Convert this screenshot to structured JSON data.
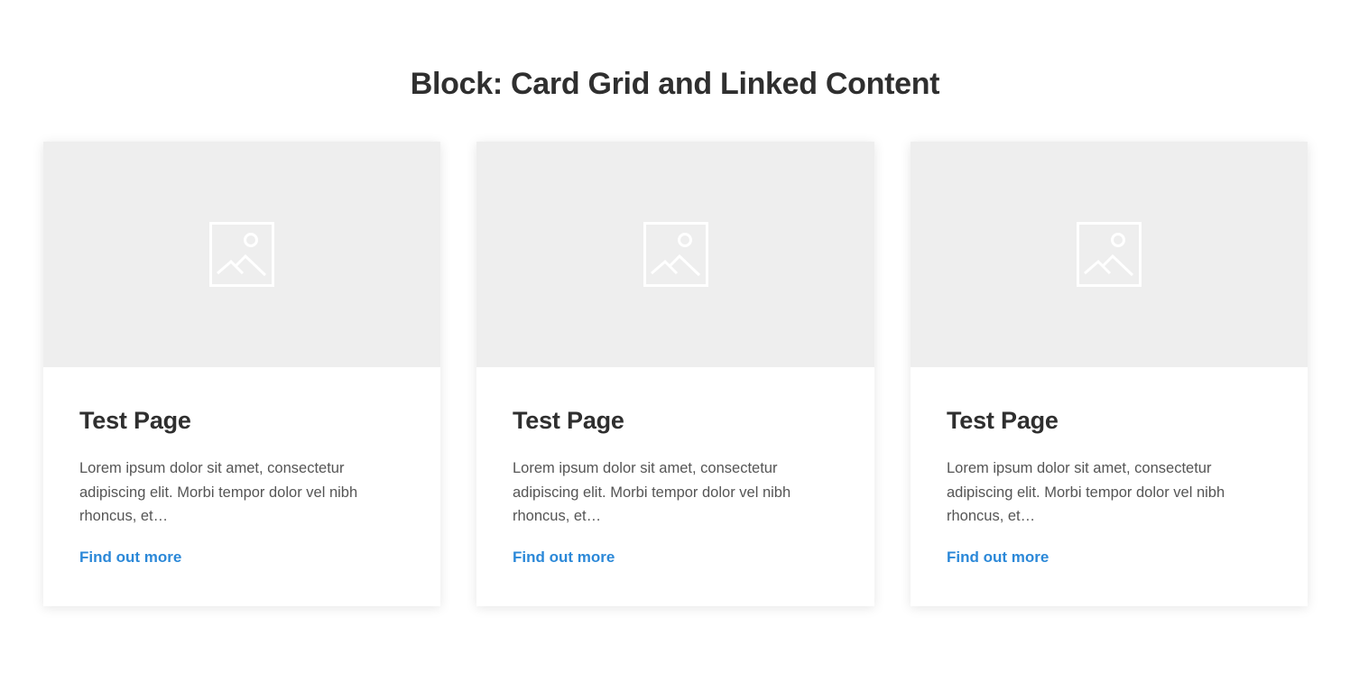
{
  "block": {
    "title": "Block: Card Grid and Linked Content"
  },
  "cards": [
    {
      "title": "Test Page",
      "excerpt": "Lorem ipsum dolor sit amet, consectetur adipiscing elit. Morbi tempor dolor vel nibh rhoncus, et…",
      "link_label": "Find out more",
      "image_icon": "image-placeholder-icon"
    },
    {
      "title": "Test Page",
      "excerpt": "Lorem ipsum dolor sit amet, consectetur adipiscing elit. Morbi tempor dolor vel nibh rhoncus, et…",
      "link_label": "Find out more",
      "image_icon": "image-placeholder-icon"
    },
    {
      "title": "Test Page",
      "excerpt": "Lorem ipsum dolor sit amet, consectetur adipiscing elit. Morbi tempor dolor vel nibh rhoncus, et…",
      "link_label": "Find out more",
      "image_icon": "image-placeholder-icon"
    }
  ],
  "colors": {
    "heading": "#2f2f2f",
    "body_text": "#555555",
    "link": "#2b88d8",
    "image_placeholder_bg": "#eeeeee",
    "placeholder_icon": "#ffffff"
  }
}
